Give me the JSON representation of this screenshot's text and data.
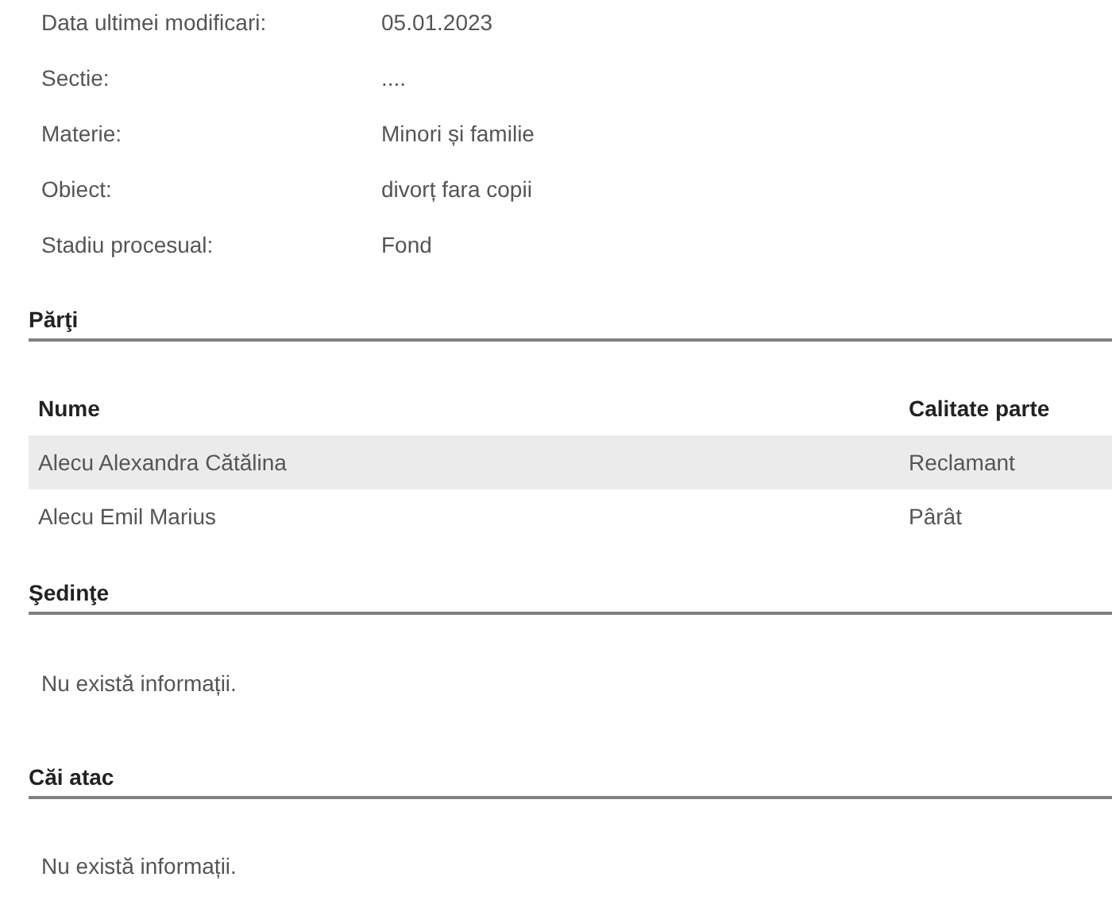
{
  "details": [
    {
      "label": "Data ultimei modificari:",
      "value": "05.01.2023"
    },
    {
      "label": "Sectie:",
      "value": "...."
    },
    {
      "label": "Materie:",
      "value": "Minori și familie"
    },
    {
      "label": "Obiect:",
      "value": "divorț fara copii"
    },
    {
      "label": "Stadiu procesual:",
      "value": "Fond"
    }
  ],
  "parti": {
    "title": "Părţi",
    "columns": [
      "Nume",
      "Calitate parte"
    ],
    "rows": [
      [
        "Alecu Alexandra Cătălina",
        "Reclamant"
      ],
      [
        "Alecu Emil Marius",
        "Pârât"
      ]
    ]
  },
  "sedinte": {
    "title": "Şedinţe",
    "message": "Nu există informații."
  },
  "cai_atac": {
    "title": "Căi atac",
    "message": "Nu există informații."
  }
}
